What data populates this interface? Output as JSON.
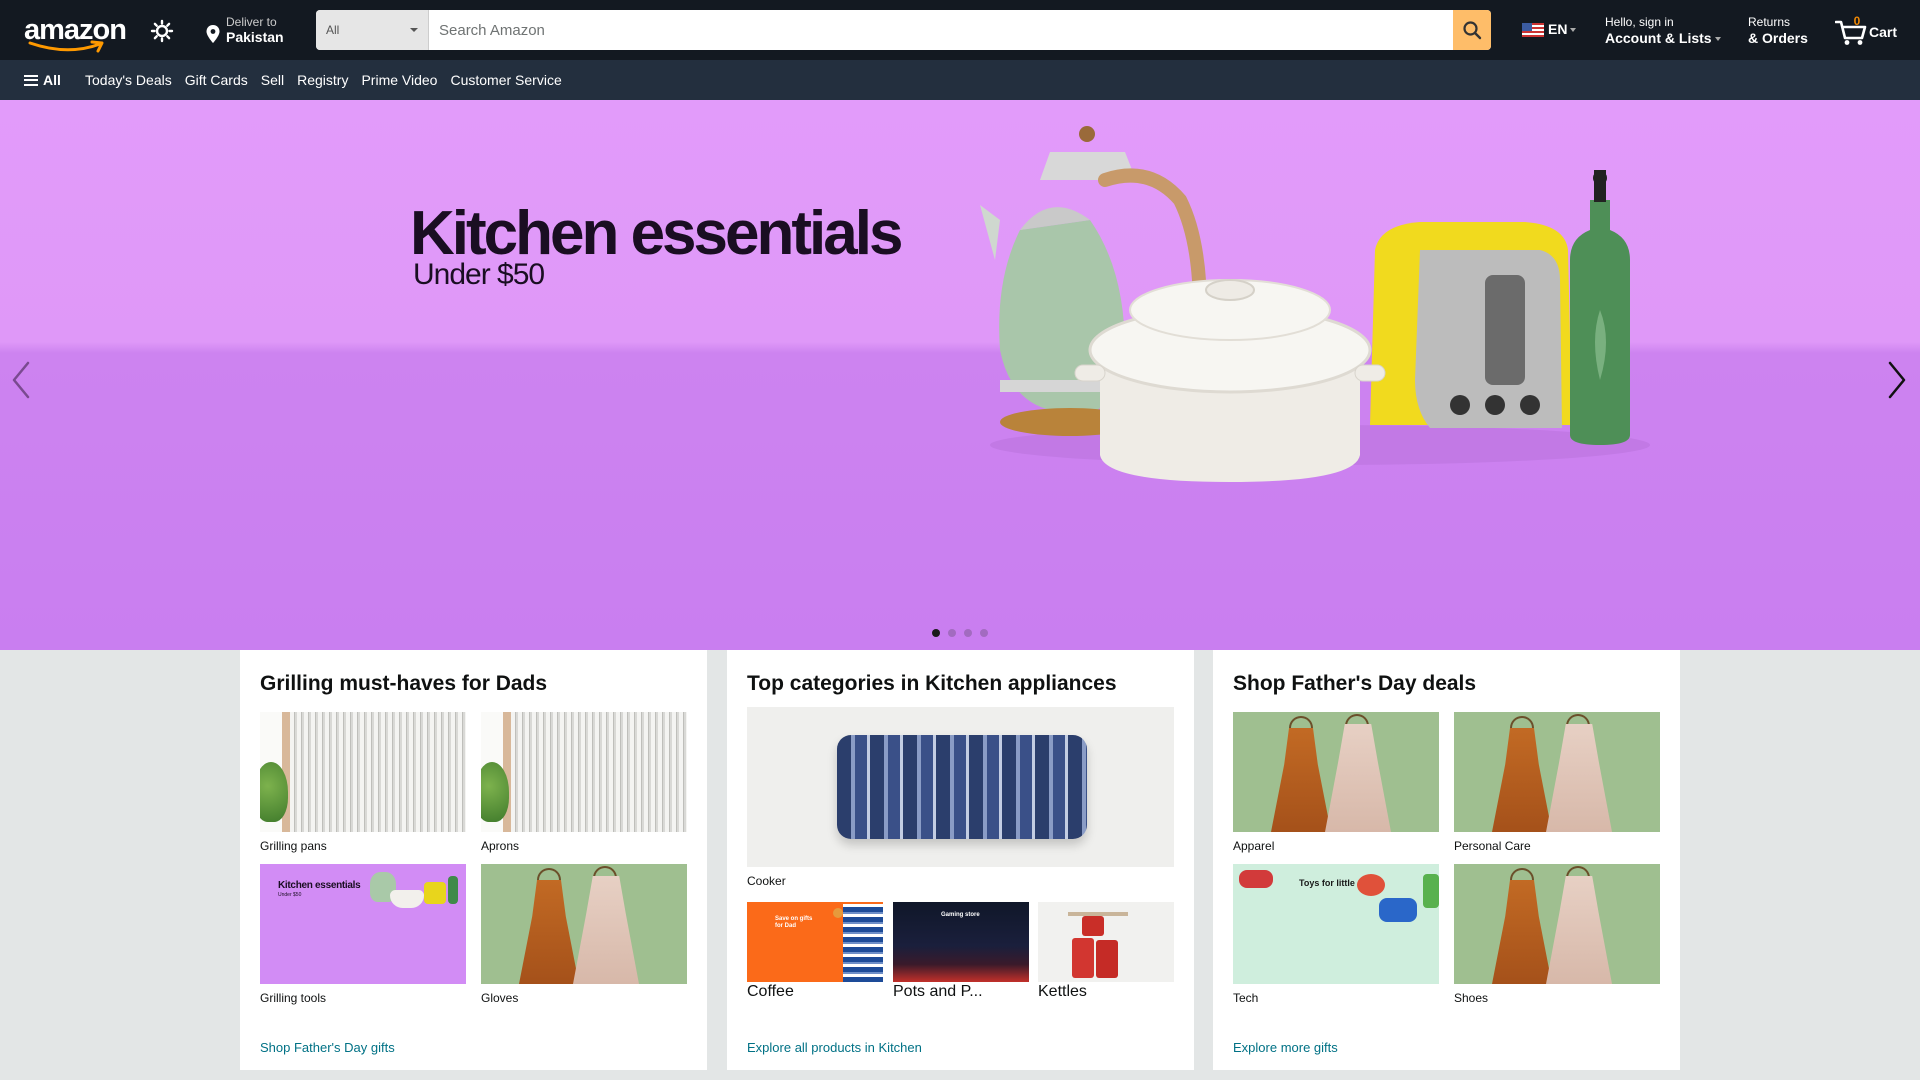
{
  "header": {
    "logo_text": "amazon",
    "deliver_line1": "Deliver to",
    "deliver_line2": "Pakistan",
    "search": {
      "category": "All",
      "placeholder": "Search Amazon"
    },
    "language": "EN",
    "account_line1": "Hello, sign in",
    "account_line2": "Account & Lists",
    "returns_line1": "Returns",
    "returns_line2": "& Orders",
    "cart_count": "0",
    "cart_label": "Cart",
    "colors": {
      "nav_bg": "#131921",
      "sub_nav_bg": "#232f3e",
      "search_button": "#febd69",
      "cart_count": "#f08804"
    }
  },
  "subnav": {
    "all_label": "All",
    "links": [
      "Today's Deals",
      "Gift Cards",
      "Sell",
      "Registry",
      "Prime Video",
      "Customer Service"
    ]
  },
  "hero": {
    "title": "Kitchen essentials",
    "subtitle": "Under $50",
    "active_slide": 1,
    "slide_count": 4,
    "bg_color": "#d98ef6"
  },
  "cards": [
    {
      "title": "Grilling must-haves for Dads",
      "tiles": [
        {
          "caption": "Grilling pans",
          "image": "blinds"
        },
        {
          "caption": "Aprons",
          "image": "blinds"
        },
        {
          "caption": "Grilling tools",
          "image": "kitchen-banner",
          "image_title": "Kitchen essentials",
          "image_sub": "Under $50"
        },
        {
          "caption": "Gloves",
          "image": "dresses"
        }
      ],
      "link": "Shop Father's Day gifts"
    },
    {
      "title": "Top categories in Kitchen appliances",
      "main_caption": "Cooker",
      "small_tiles": [
        {
          "caption": "Coffee",
          "image": "fathers-day-banner",
          "image_text": "Save on gifts for Dad"
        },
        {
          "caption": "Pots and P...",
          "image": "gaming-store-banner",
          "image_text": "Gaming store"
        },
        {
          "caption": "Kettles",
          "image": "cans-on-shelf"
        }
      ],
      "link": "Explore all products in Kitchen"
    },
    {
      "title": "Shop Father's Day deals",
      "tiles": [
        {
          "caption": "Apparel",
          "image": "dresses"
        },
        {
          "caption": "Personal Care",
          "image": "dresses"
        },
        {
          "caption": "Tech",
          "image": "toys-banner",
          "image_text": "Toys for little ones"
        },
        {
          "caption": "Shoes",
          "image": "dresses"
        }
      ],
      "link": "Explore more gifts"
    }
  ]
}
